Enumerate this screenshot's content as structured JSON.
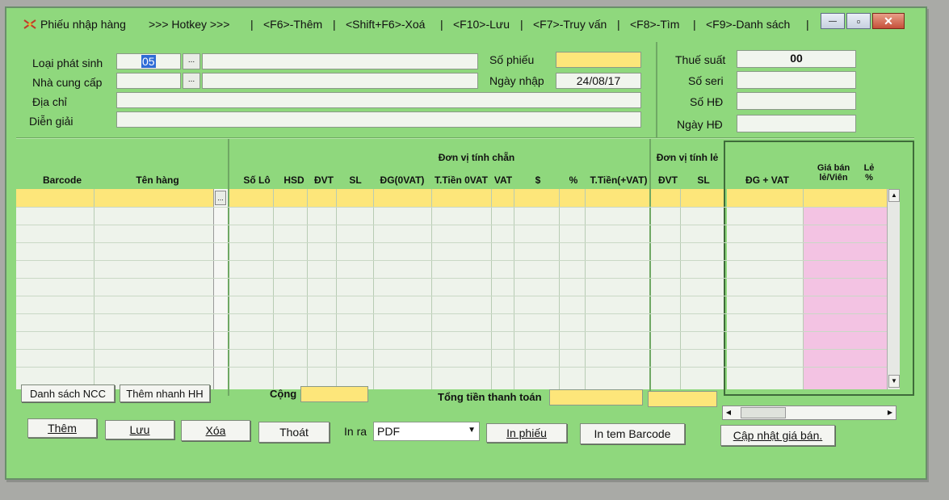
{
  "title": {
    "app_label": "Phiếu nhập hàng",
    "hotkey_label": ">>> Hotkey >>>",
    "shortcuts": [
      "<F6>-Thêm",
      "<Shift+F6>-Xoá",
      "<F10>-Lưu",
      "<F7>-Truy vấn",
      "<F8>-Tìm",
      "<F9>-Danh sách"
    ],
    "separator": "|"
  },
  "window_controls": {
    "minimize": "—",
    "maximize": "▫",
    "close": "✕"
  },
  "form": {
    "loai_phat_sinh": {
      "label": "Loại phát sinh",
      "code": "05",
      "name": ""
    },
    "nha_cung_cap": {
      "label": "Nhà cung cấp",
      "code": "",
      "name": ""
    },
    "dia_chi": {
      "label": "Địa chỉ",
      "value": ""
    },
    "dien_giai": {
      "label": "Diễn giải",
      "value": ""
    },
    "so_phieu": {
      "label": "Số phiếu",
      "value": ""
    },
    "ngay_nhap": {
      "label": "Ngày nhập",
      "value": "24/08/17"
    },
    "thue_suat": {
      "label": "Thuế suất",
      "value": "00"
    },
    "so_seri": {
      "label": "Số seri",
      "value": ""
    },
    "so_hd": {
      "label": "Số HĐ",
      "value": ""
    },
    "ngay_hd": {
      "label": "Ngày HĐ",
      "value": ""
    },
    "ellipsis": "..."
  },
  "grid": {
    "group_headers": {
      "don_vi_tinh_chan": "Đơn vị tính chẵn",
      "don_vi_tinh_le": "Đơn vị tính lẻ"
    },
    "columns_left": [
      "Barcode",
      "Tên hàng"
    ],
    "columns_chan": [
      "Số Lô",
      "HSD",
      "ĐVT",
      "SL",
      "ĐG(0VAT)",
      "T.Tiền 0VAT",
      "VAT",
      "$",
      "%",
      "T.Tiền(+VAT)"
    ],
    "columns_le": [
      "ĐVT",
      "SL"
    ],
    "columns_right": [
      "ĐG + VAT",
      "Giá bán lẻ/Viên",
      "Lẻ %"
    ],
    "row_count": 11
  },
  "totals": {
    "cong_label": "Cộng",
    "cong_value": "",
    "tong_label": "Tổng tiền thanh toán",
    "tong_value": "",
    "tong_le_value": ""
  },
  "buttons": {
    "danh_sach_ncc": "Danh sách NCC",
    "them_nhanh_hh": "Thêm nhanh HH",
    "them": "Thêm",
    "luu": "Lưu",
    "xoa": "Xóa",
    "thoat": "Thoát",
    "in_ra_label": "In ra",
    "in_ra_value": "PDF",
    "in_phieu": "In phiếu",
    "in_tem_barcode": "In tem Barcode",
    "cap_nhat_gia_ban": "Cập nhật giá bán."
  },
  "colors": {
    "window_bg": "#8fd87d",
    "grid_bg": "#eef3eb",
    "highlight_row": "#fde67a",
    "pink_col": "#f3c3e3"
  }
}
